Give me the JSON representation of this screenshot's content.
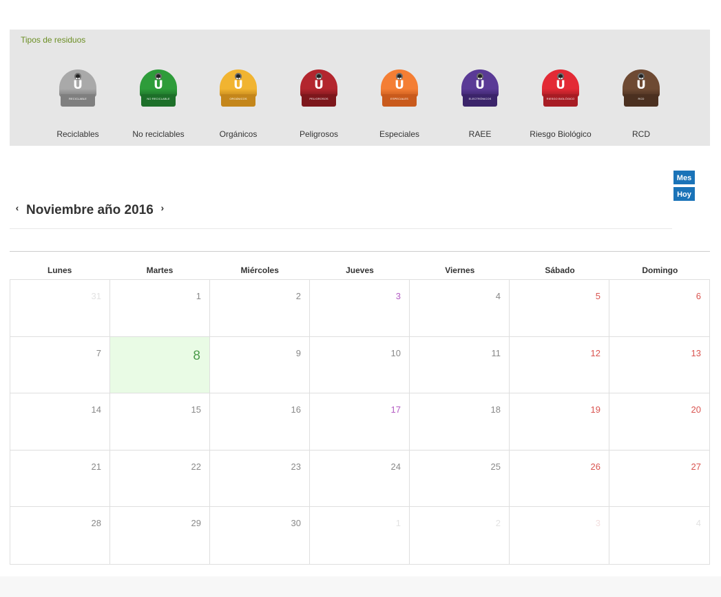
{
  "waste_panel": {
    "title": "Tipos de residuos",
    "bins": [
      {
        "label": "Reciclables",
        "tag": "Reciclable",
        "color": "#a9a9a9",
        "base": "#7f7f7f",
        "glyph": "Ü"
      },
      {
        "label": "No reciclables",
        "tag": "No reciclable",
        "color": "#2e9c3a",
        "base": "#1d6f29",
        "glyph": "Ü"
      },
      {
        "label": "Orgánicos",
        "tag": "Orgánicos",
        "color": "#f1b431",
        "base": "#c4861b",
        "glyph": "Ü"
      },
      {
        "label": "Peligrosos",
        "tag": "Peligrosos",
        "color": "#b3262e",
        "base": "#7d171c",
        "glyph": "Ü"
      },
      {
        "label": "Especiales",
        "tag": "Especiales",
        "color": "#f47e34",
        "base": "#c95a1c",
        "glyph": "Ü"
      },
      {
        "label": "RAEE",
        "tag": "Electrónicos",
        "color": "#5a3a96",
        "base": "#3b246a",
        "glyph": "Ü"
      },
      {
        "label": "Riesgo Biológico",
        "tag": "Riesgo biológico",
        "color": "#e32a35",
        "base": "#a71c24",
        "glyph": "Ü"
      },
      {
        "label": "RCD",
        "tag": "RCD",
        "color": "#6e4a33",
        "base": "#4b3020",
        "glyph": "Ü"
      }
    ]
  },
  "view_buttons": {
    "month": "Mes",
    "today": "Hoy"
  },
  "calendar": {
    "title": "Noviembre año 2016",
    "prev_icon": "‹",
    "next_icon": "›",
    "weekdays": [
      "Lunes",
      "Martes",
      "Miércoles",
      "Jueves",
      "Viernes",
      "Sábado",
      "Domingo"
    ],
    "weeks": [
      [
        {
          "d": "31",
          "t": "other"
        },
        {
          "d": "1",
          "t": ""
        },
        {
          "d": "2",
          "t": ""
        },
        {
          "d": "3",
          "t": "holiday"
        },
        {
          "d": "4",
          "t": ""
        },
        {
          "d": "5",
          "t": "weekend"
        },
        {
          "d": "6",
          "t": "weekend"
        }
      ],
      [
        {
          "d": "7",
          "t": ""
        },
        {
          "d": "8",
          "t": "today"
        },
        {
          "d": "9",
          "t": ""
        },
        {
          "d": "10",
          "t": ""
        },
        {
          "d": "11",
          "t": ""
        },
        {
          "d": "12",
          "t": "weekend"
        },
        {
          "d": "13",
          "t": "weekend"
        }
      ],
      [
        {
          "d": "14",
          "t": ""
        },
        {
          "d": "15",
          "t": ""
        },
        {
          "d": "16",
          "t": ""
        },
        {
          "d": "17",
          "t": "holiday"
        },
        {
          "d": "18",
          "t": ""
        },
        {
          "d": "19",
          "t": "weekend"
        },
        {
          "d": "20",
          "t": "weekend"
        }
      ],
      [
        {
          "d": "21",
          "t": ""
        },
        {
          "d": "22",
          "t": ""
        },
        {
          "d": "23",
          "t": ""
        },
        {
          "d": "24",
          "t": ""
        },
        {
          "d": "25",
          "t": ""
        },
        {
          "d": "26",
          "t": "weekend"
        },
        {
          "d": "27",
          "t": "weekend"
        }
      ],
      [
        {
          "d": "28",
          "t": ""
        },
        {
          "d": "29",
          "t": ""
        },
        {
          "d": "30",
          "t": ""
        },
        {
          "d": "1",
          "t": "other"
        },
        {
          "d": "2",
          "t": "other"
        },
        {
          "d": "3",
          "t": "other weekend"
        },
        {
          "d": "4",
          "t": "other"
        }
      ]
    ]
  }
}
